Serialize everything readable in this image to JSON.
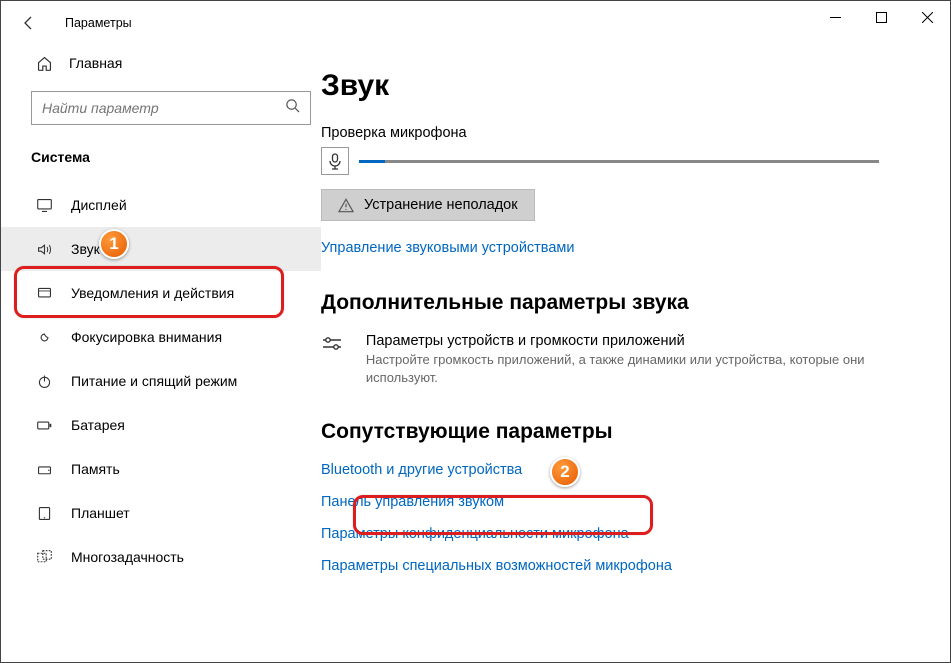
{
  "window": {
    "title": "Параметры",
    "min": "—",
    "max": "",
    "close": ""
  },
  "sidebar": {
    "home": "Главная",
    "search_placeholder": "Найти параметр",
    "section": "Система",
    "items": [
      {
        "label": "Дисплей"
      },
      {
        "label": "Звук"
      },
      {
        "label": "Уведомления и действия"
      },
      {
        "label": "Фокусировка внимания"
      },
      {
        "label": "Питание и спящий режим"
      },
      {
        "label": "Батарея"
      },
      {
        "label": "Память"
      },
      {
        "label": "Планшет"
      },
      {
        "label": "Многозадачность"
      }
    ]
  },
  "main": {
    "heading": "Звук",
    "mic_label": "Проверка микрофона",
    "troubleshoot": "Устранение неполадок",
    "manage_devices": "Управление звуковыми устройствами",
    "advanced_heading": "Дополнительные параметры звука",
    "option_title": "Параметры устройств и громкости приложений",
    "option_desc": "Настройте громкость приложений, а также динамики или устройства, которые они используют.",
    "related_heading": "Сопутствующие параметры",
    "links": [
      "Bluetooth и другие устройства",
      "Панель управления звуком",
      "Параметры конфиденциальности микрофона",
      "Параметры специальных возможностей микрофона"
    ]
  },
  "annotations": {
    "one": "1",
    "two": "2"
  }
}
